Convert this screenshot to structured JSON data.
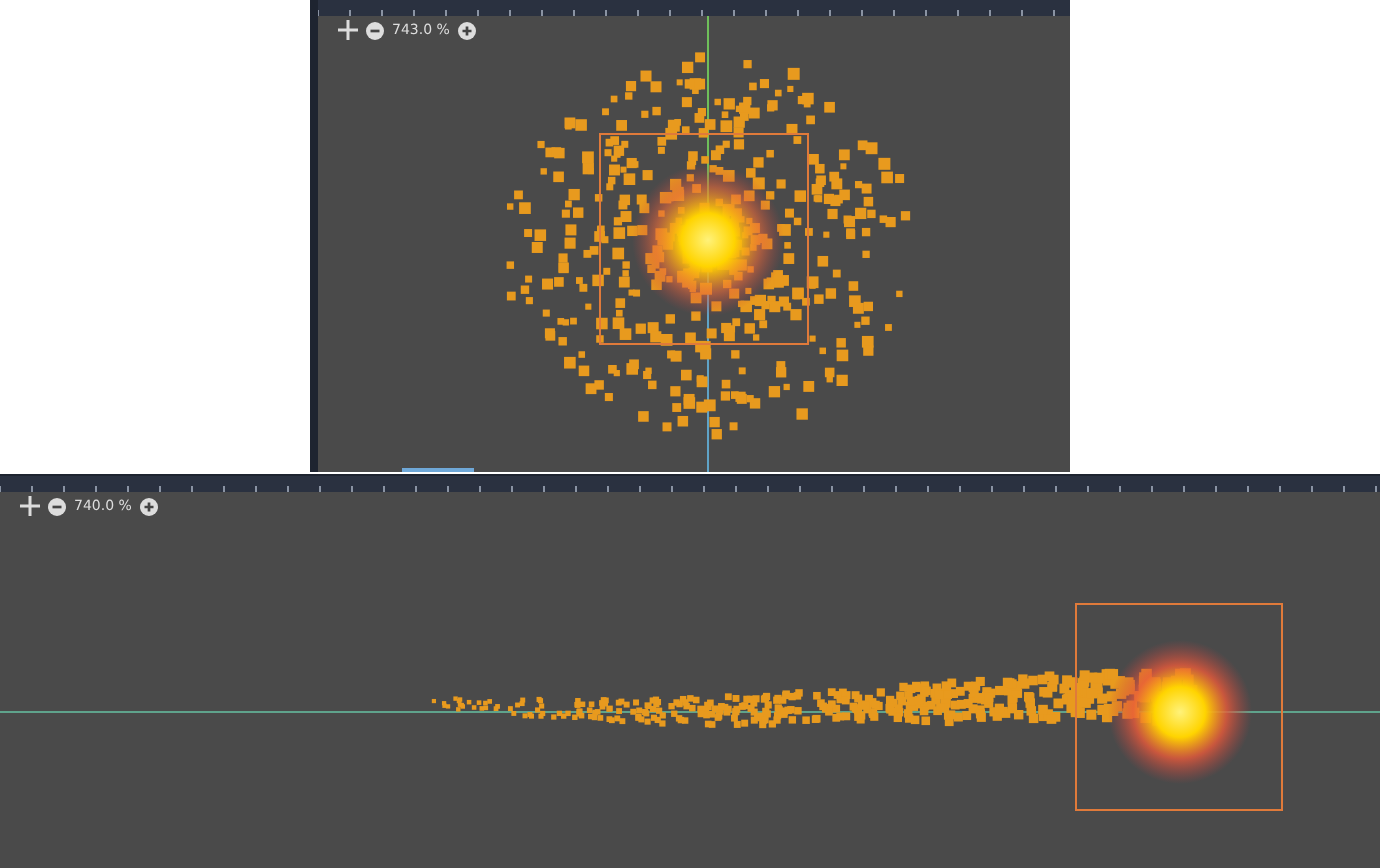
{
  "viewports": [
    {
      "zoom": "743.0 %"
    },
    {
      "zoom": "740.0 %"
    }
  ]
}
